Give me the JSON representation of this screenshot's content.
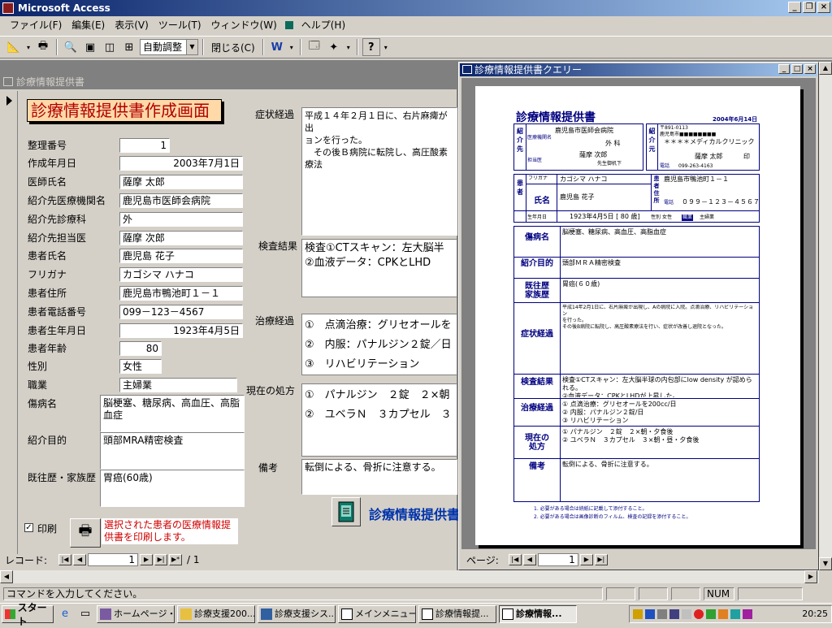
{
  "app": {
    "title": "Microsoft Access"
  },
  "menu": [
    "ファイル(F)",
    "編集(E)",
    "表示(V)",
    "ツール(T)",
    "ウィンドウ(W)",
    "ヘルプ(H)"
  ],
  "toolbar": {
    "zoom_value": "自動調整",
    "close_label": "閉じる(C)",
    "help_label": "?"
  },
  "form": {
    "window_title": "診療情報提供書",
    "heading": "診療情報提供書作成画面",
    "labels": {
      "number": "整理番号",
      "created": "作成年月日",
      "doctor": "医師氏名",
      "ref_inst": "紹介先医療機関名",
      "ref_dept": "紹介先診療科",
      "ref_staff": "紹介先担当医",
      "patient": "患者氏名",
      "kana": "フリガナ",
      "address": "患者住所",
      "phone": "患者電話番号",
      "birth": "患者生年月日",
      "age": "患者年齢",
      "sex": "性別",
      "job": "職業",
      "disease": "傷病名",
      "purpose": "紹介目的",
      "history": "既往歴・家族歴",
      "symptom": "症状経過",
      "exam": "検査結果",
      "treatment": "治療経過",
      "prescription": "現在の処方",
      "remarks": "備考"
    },
    "values": {
      "number": "1",
      "created": "2003年7月1日",
      "doctor": "薩摩 太郎",
      "ref_inst": "鹿児島市医師会病院",
      "ref_dept": "外",
      "ref_staff": "薩摩 次郎",
      "patient": "鹿児島 花子",
      "kana": "カゴシマ ハナコ",
      "address": "鹿児島市鴨池町１－１",
      "phone": "099－123－4567",
      "birth": "1923年4月5日",
      "age": "80",
      "sex": "女性",
      "job": "主婦業",
      "disease": "脳梗塞、糖尿病、高血圧、高脂血症",
      "purpose": "頭部MRA精密検査",
      "history": "胃癌(60歳)",
      "symptom": "平成１４年２月１日に、右片麻痺が出\nョンを行った。\n　その後Ｂ病院に転院し、高圧酸素療法",
      "exam": "検査①CTスキャン：左大脳半\n②血液データ：CPKとLHD",
      "treatment": "①　点滴治療：グリセオールを\n②　内服：パナルジン２錠／日\n③　リハビリテーション",
      "prescription": "①　パナルジン　２錠　２×朝\n②　ユベラＮ　３カプセル　３",
      "remarks": "転倒による、骨折に注意する。"
    },
    "print_label": "印刷",
    "print_note": "選択された患者の医療情報提供書を印刷します。",
    "report_button_label": "診療情報提供書",
    "nav": {
      "record_label": "レコード:",
      "current": "1",
      "total": "/ 1"
    }
  },
  "query": {
    "window_title": "診療情報提供書クエリー",
    "page_label": "ページ:",
    "page_current": "1",
    "report": {
      "title": "診療情報提供書",
      "date": "2004年6月14日",
      "ref_section": "紹介先",
      "ref_inst_label": "医療機関名",
      "ref_inst": "鹿児島市医師会病院",
      "ref_dept": "外 科",
      "ref_staff_label": "担当医",
      "ref_staff": "薩摩 次郎",
      "ref_staff_sub": "先生御机下",
      "src_section": "紹介元",
      "src_zip": "〒891-0113",
      "src_addr": "鹿児島市■■■■■■■■",
      "src_clinic": "＊＊＊＊メディカルクリニック",
      "src_doctor": "薩摩 太郎",
      "src_seal": "印",
      "src_phone_label": "電話",
      "src_phone": "099-263-4163",
      "patient_section": "患者",
      "kana_label": "フリガナ",
      "kana": "カゴシマ ハナコ",
      "name_label": "氏名",
      "name": "鹿児島 花子",
      "addr_label": "患者住所",
      "addr": "鹿児島市鴨池町１－１",
      "phone_label": "電話",
      "phone": "０９９－１２３－４５６７",
      "birth_label": "生年月日",
      "birth": "1923年4月5日 [ 80 歳]",
      "sex_label": "性別",
      "sex": "女性",
      "job_label": "職業",
      "job": "主婦業",
      "rows": [
        {
          "label": "傷病名",
          "text": "脳梗塞、糖尿病、高血圧、高脂血症"
        },
        {
          "label": "紹介目的",
          "text": "頭部ＭＲＡ精密検査"
        },
        {
          "label": "既往歴\n家族歴",
          "text": "胃癌(６０歳)"
        },
        {
          "label": "症状経過",
          "text": "平成14年2月1日に、右片麻痺が出現し、Aの病院に入院。点滴治療、リハビリテーション\nを行った。\nその後B病院に転院し、高圧酸素療法を行い、症状が改善し退院となった。"
        },
        {
          "label": "検査結果",
          "text": "検査①CTスキャン：左大脳半球の内包部にlow density が認められる。\n②血液データ：CPKとLHDが上昇した。"
        },
        {
          "label": "治療経過",
          "text": "① 点滴治療：グリセオールを200cc/日\n② 内服：パナルジン２錠/日\n③ リハビリテーション"
        },
        {
          "label": "現在の\n処方",
          "text": "① パナルジン　２錠　２×朝・夕食後\n② ユベラＮ　３カプセル　３×朝・昼・夕食後"
        },
        {
          "label": "備考",
          "text": "転倒による、骨折に注意する。"
        }
      ],
      "footer1": "1. 必要がある場合は続紙に記載して添付すること。",
      "footer2": "2. 必要がある場合は画像診断のフィルム、検査の記録を添付すること。"
    }
  },
  "status": {
    "text": "コマンドを入力してください。",
    "num": "NUM"
  },
  "taskbar": {
    "start": "スタート",
    "tasks": [
      "ホームページ・...",
      "診療支援200...",
      "診療支援シス...",
      "メインメニュー：...",
      "診療情報提...",
      "診療情報..."
    ],
    "clock": "20:25"
  }
}
